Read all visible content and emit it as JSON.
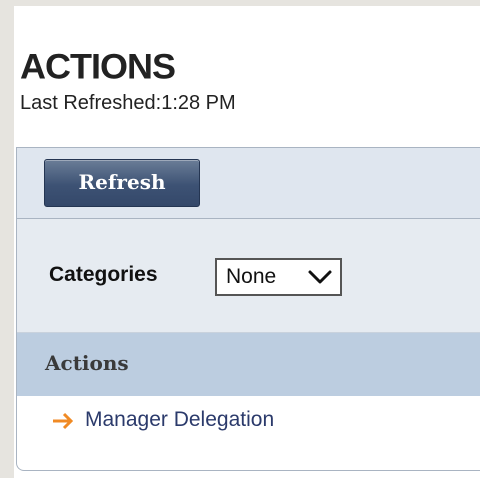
{
  "header": {
    "title": "ACTIONS",
    "last_refreshed": "Last Refreshed:1:28 PM"
  },
  "toolbar": {
    "refresh_label": "Refresh"
  },
  "filter": {
    "categories_label": "Categories",
    "selected_value": "None"
  },
  "section": {
    "title": "Actions",
    "items": [
      {
        "label": "Manager Delegation"
      }
    ]
  },
  "colors": {
    "accent_arrow": "#f08a24",
    "link": "#2b3a6b",
    "section_bg": "#bccde0",
    "button_bg": "#3d5274"
  }
}
